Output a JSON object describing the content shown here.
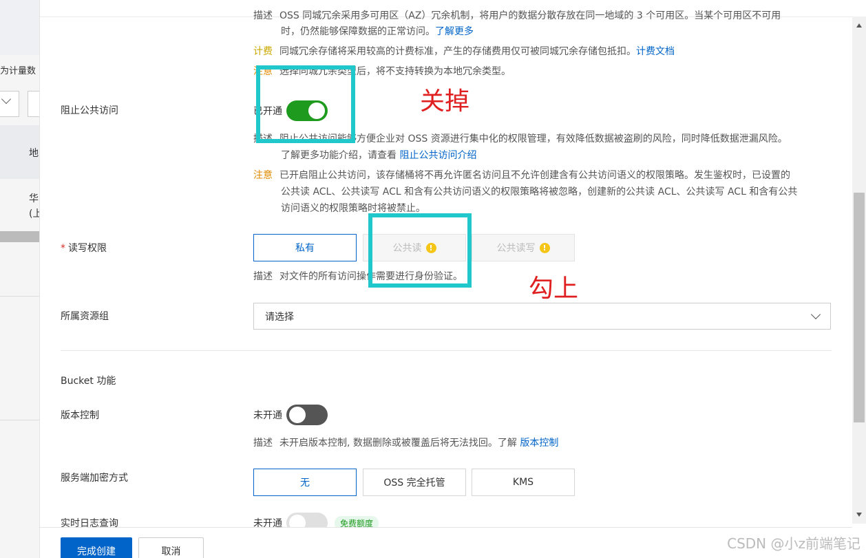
{
  "background": {
    "text_top": "为计量数",
    "cell_a": "地",
    "cell_b_line1": "华",
    "cell_b_line2": "(上"
  },
  "redundancy": {
    "desc_tag": "描述",
    "desc_line1": "OSS 同城冗余采用多可用区（AZ）冗余机制，将用户的数据分散存放在同一地域的 3 个可用区。当某个可用区不可用",
    "desc_line2": "时，仍然能够保障数据的正常访问。",
    "desc_link": "了解更多",
    "fee_tag": "计费",
    "fee_text": "同城冗余存储将采用较高的计费标准，产生的存储费用仅可被同城冗余存储包抵扣。",
    "fee_link": "计费文档",
    "note_tag": "注意",
    "note_text": "选择同城冗余类型后，将不支持转换为本地冗余类型。"
  },
  "block_public": {
    "label": "阻止公共访问",
    "status": "已开通",
    "desc_tag": "描述",
    "desc_line1": "阻止公共访问能够方便企业对 OSS 资源进行集中化的权限管理，有效降低数据被盗刷的风险，同时降低数据泄漏风险。",
    "desc_line2": "了解更多功能介绍，请查看",
    "desc_link": "阻止公共访问介绍",
    "note_tag": "注意",
    "note_line1": "已开启阻止公共访问，该存储桶将不再允许匿名访问且不允许创建含有公共访问语义的权限策略。发生鉴权时，已设置的",
    "note_line2": "公共读 ACL、公共读写 ACL 和含有公共访问语义的权限策略将被忽略，创建新的公共读 ACL、公共读写 ACL 和含有公共",
    "note_line3": "访问语义的权限策略时将被禁止。"
  },
  "acl": {
    "required_mark": "*",
    "label": "读写权限",
    "options": [
      "私有",
      "公共读",
      "公共读写"
    ],
    "desc_tag": "描述",
    "desc_text": "对文件的所有访问操作需要进行身份验证。"
  },
  "resource_group": {
    "label": "所属资源组",
    "placeholder": "请选择"
  },
  "bucket_features": {
    "title": "Bucket 功能"
  },
  "versioning": {
    "label": "版本控制",
    "status": "未开通",
    "desc_tag": "描述",
    "desc_text": "未开启版本控制, 数据删除或被覆盖后将无法找回。了解",
    "desc_link": "版本控制"
  },
  "encryption": {
    "label": "服务端加密方式",
    "options": [
      "无",
      "OSS 完全托管",
      "KMS"
    ]
  },
  "realtime_log": {
    "label": "实时日志查询",
    "status": "未开通",
    "badge": "免费额度"
  },
  "footer": {
    "create": "完成创建",
    "cancel": "取消"
  },
  "annotations": {
    "turn_off": "关掉",
    "check": "勾上"
  },
  "watermark": "CSDN @小z前端笔记",
  "colors": {
    "primary": "#0064c8",
    "switch_on": "#1e9a1e",
    "annotation_box": "#20c8cc",
    "annotation_text": "#e02020"
  }
}
